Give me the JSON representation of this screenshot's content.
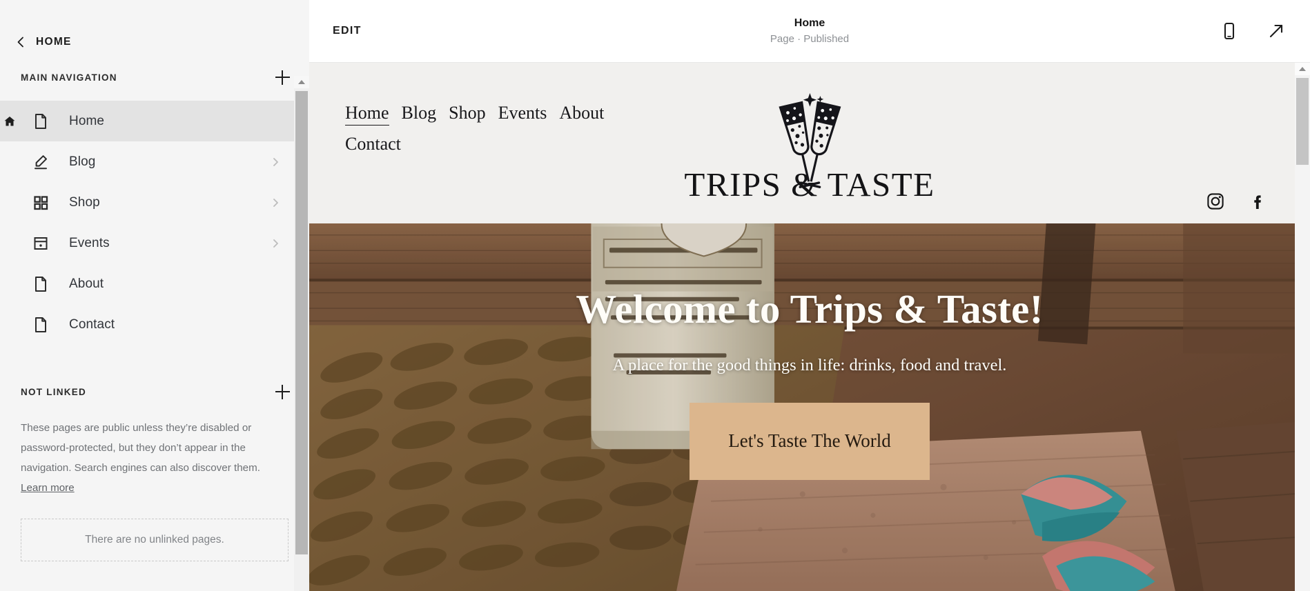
{
  "sidebar": {
    "back": {
      "label": "HOME",
      "icon": "chevron-left-icon"
    },
    "main_navigation": {
      "title": "MAIN NAVIGATION",
      "add_label": "+",
      "items": [
        {
          "label": "Home",
          "icon": "page-icon",
          "active": true,
          "has_chevron": false,
          "is_home": true
        },
        {
          "label": "Blog",
          "icon": "pen-icon",
          "active": false,
          "has_chevron": true,
          "is_home": false
        },
        {
          "label": "Shop",
          "icon": "grid-icon",
          "active": false,
          "has_chevron": true,
          "is_home": false
        },
        {
          "label": "Events",
          "icon": "window-icon",
          "active": false,
          "has_chevron": true,
          "is_home": false
        },
        {
          "label": "About",
          "icon": "page-icon",
          "active": false,
          "has_chevron": false,
          "is_home": false
        },
        {
          "label": "Contact",
          "icon": "page-icon",
          "active": false,
          "has_chevron": false,
          "is_home": false
        }
      ]
    },
    "not_linked": {
      "title": "NOT LINKED",
      "add_label": "+",
      "description": "These pages are public unless they’re disabled or password-protected, but they don’t appear in the navigation. Search engines can also discover them. ",
      "learn_more": "Learn more",
      "empty_state": "There are no unlinked pages."
    }
  },
  "topbar": {
    "edit_label": "EDIT",
    "page_title": "Home",
    "page_status": "Page · Published",
    "mobile_icon": "mobile-preview-icon",
    "open_icon": "open-external-icon"
  },
  "site": {
    "nav": [
      {
        "label": "Home",
        "active": true
      },
      {
        "label": "Blog",
        "active": false
      },
      {
        "label": "Shop",
        "active": false
      },
      {
        "label": "Events",
        "active": false
      },
      {
        "label": "About",
        "active": false
      },
      {
        "label": "Contact",
        "active": false
      }
    ],
    "logo_text": "TRIPS & TASTE",
    "social": [
      {
        "name": "instagram-icon"
      },
      {
        "name": "facebook-icon"
      }
    ],
    "hero": {
      "title": "Welcome to Trips & Taste!",
      "subtitle": "A place for the good things in life: drinks, food and travel.",
      "cta_label": "Let's Taste The World",
      "cta_color": "#dcb68d"
    }
  },
  "colors": {
    "sidebar_bg": "#f5f5f5",
    "active_row": "#e3e3e3",
    "canvas_bg": "#f1f0ee",
    "accent_tan": "#dcb68d",
    "text_dark": "#1c1c1c",
    "text_muted": "#6f7276"
  }
}
